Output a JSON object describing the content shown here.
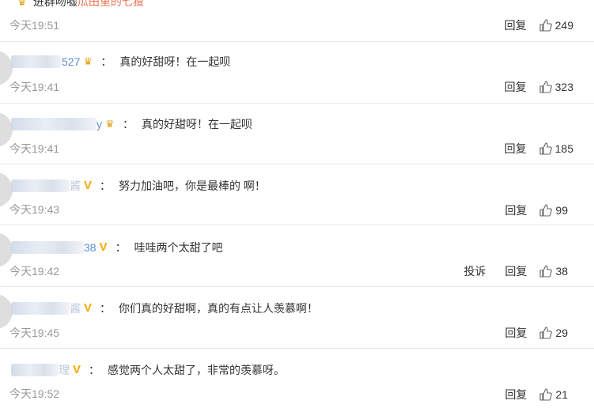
{
  "top_partial": {
    "text": "进群吻嘘",
    "link": "瓜田里的七猹"
  },
  "labels": {
    "reply": "回复",
    "report": "投诉",
    "colon": "："
  },
  "comments": [
    {
      "time": "今天19:51",
      "likes": "249",
      "text": "",
      "name_tail": ""
    },
    {
      "time": "今天19:41",
      "likes": "323",
      "text": "真的好甜呀！在一起呗",
      "name_tail": "527",
      "badge": "crown"
    },
    {
      "time": "今天19:41",
      "likes": "185",
      "text": "真的好甜呀！在一起呗",
      "name_tail": "y",
      "badge": "crown"
    },
    {
      "time": "今天19:43",
      "likes": "99",
      "text": "努力加油吧，你是最棒的 啊！",
      "name_tail": "酱",
      "badge": "v"
    },
    {
      "time": "今天19:42",
      "likes": "38",
      "text": "哇哇两个太甜了吧",
      "name_tail": "38",
      "badge": "v",
      "report": true
    },
    {
      "time": "今天19:45",
      "likes": "29",
      "text": "你们真的好甜啊，真的有点让人羡慕啊！",
      "name_tail": "酱",
      "badge": "v"
    },
    {
      "time": "今天19:52",
      "likes": "21",
      "text": "感觉两个人太甜了，非常的羡慕呀。",
      "name_tail": "理",
      "badge": "v"
    }
  ],
  "colors": {
    "name": "#5a8ed0",
    "vip": "#f5a800",
    "crown": "#e2a31a",
    "muted": "#999999"
  }
}
